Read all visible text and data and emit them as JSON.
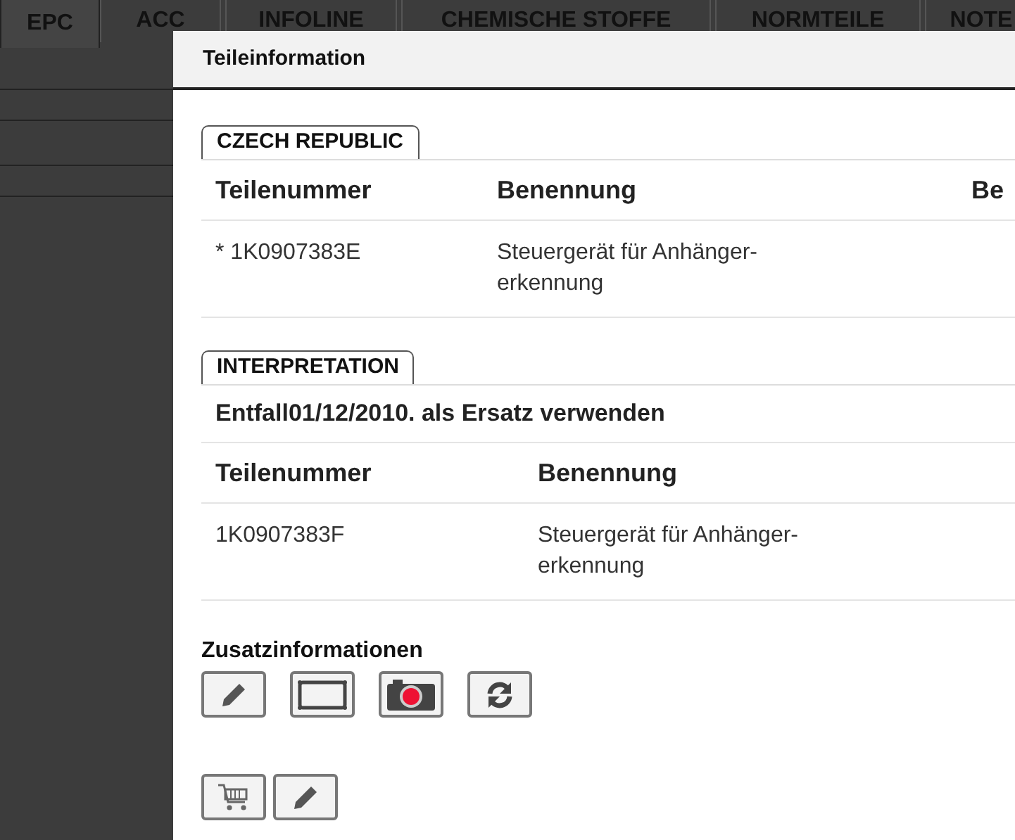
{
  "tabs": [
    {
      "label": "EPC",
      "selected": true
    },
    {
      "label": "ACC",
      "selected": false
    },
    {
      "label": "INFOLINE",
      "selected": false
    },
    {
      "label": "CHEMISCHE STOFFE",
      "selected": false
    },
    {
      "label": "NORMTEILE",
      "selected": false
    },
    {
      "label": "NOTE",
      "selected": false
    }
  ],
  "dialog": {
    "title": "Teileinformation",
    "sections": [
      {
        "label": "CZECH REPUBLIC",
        "columns": [
          "Teilenummer",
          "Benennung",
          "Be"
        ],
        "rows": [
          [
            "* 1K0907383E",
            "Steuergerät für Anhänger-erkennung",
            ""
          ]
        ]
      },
      {
        "label": "INTERPRETATION",
        "note": "Entfall01/12/2010. als Ersatz verwenden",
        "columns": [
          "Teilenummer",
          "Benennung"
        ],
        "rows": [
          [
            "1K0907383F",
            "Steuergerät für Anhänger-erkennung"
          ]
        ]
      }
    ],
    "extra_title": "Zusatzinformationen",
    "extra_buttons": [
      {
        "kind": "pencil"
      },
      {
        "kind": "frame"
      },
      {
        "kind": "camera"
      },
      {
        "kind": "refresh"
      }
    ],
    "action_buttons": [
      {
        "kind": "cart"
      },
      {
        "kind": "pencil"
      }
    ]
  }
}
